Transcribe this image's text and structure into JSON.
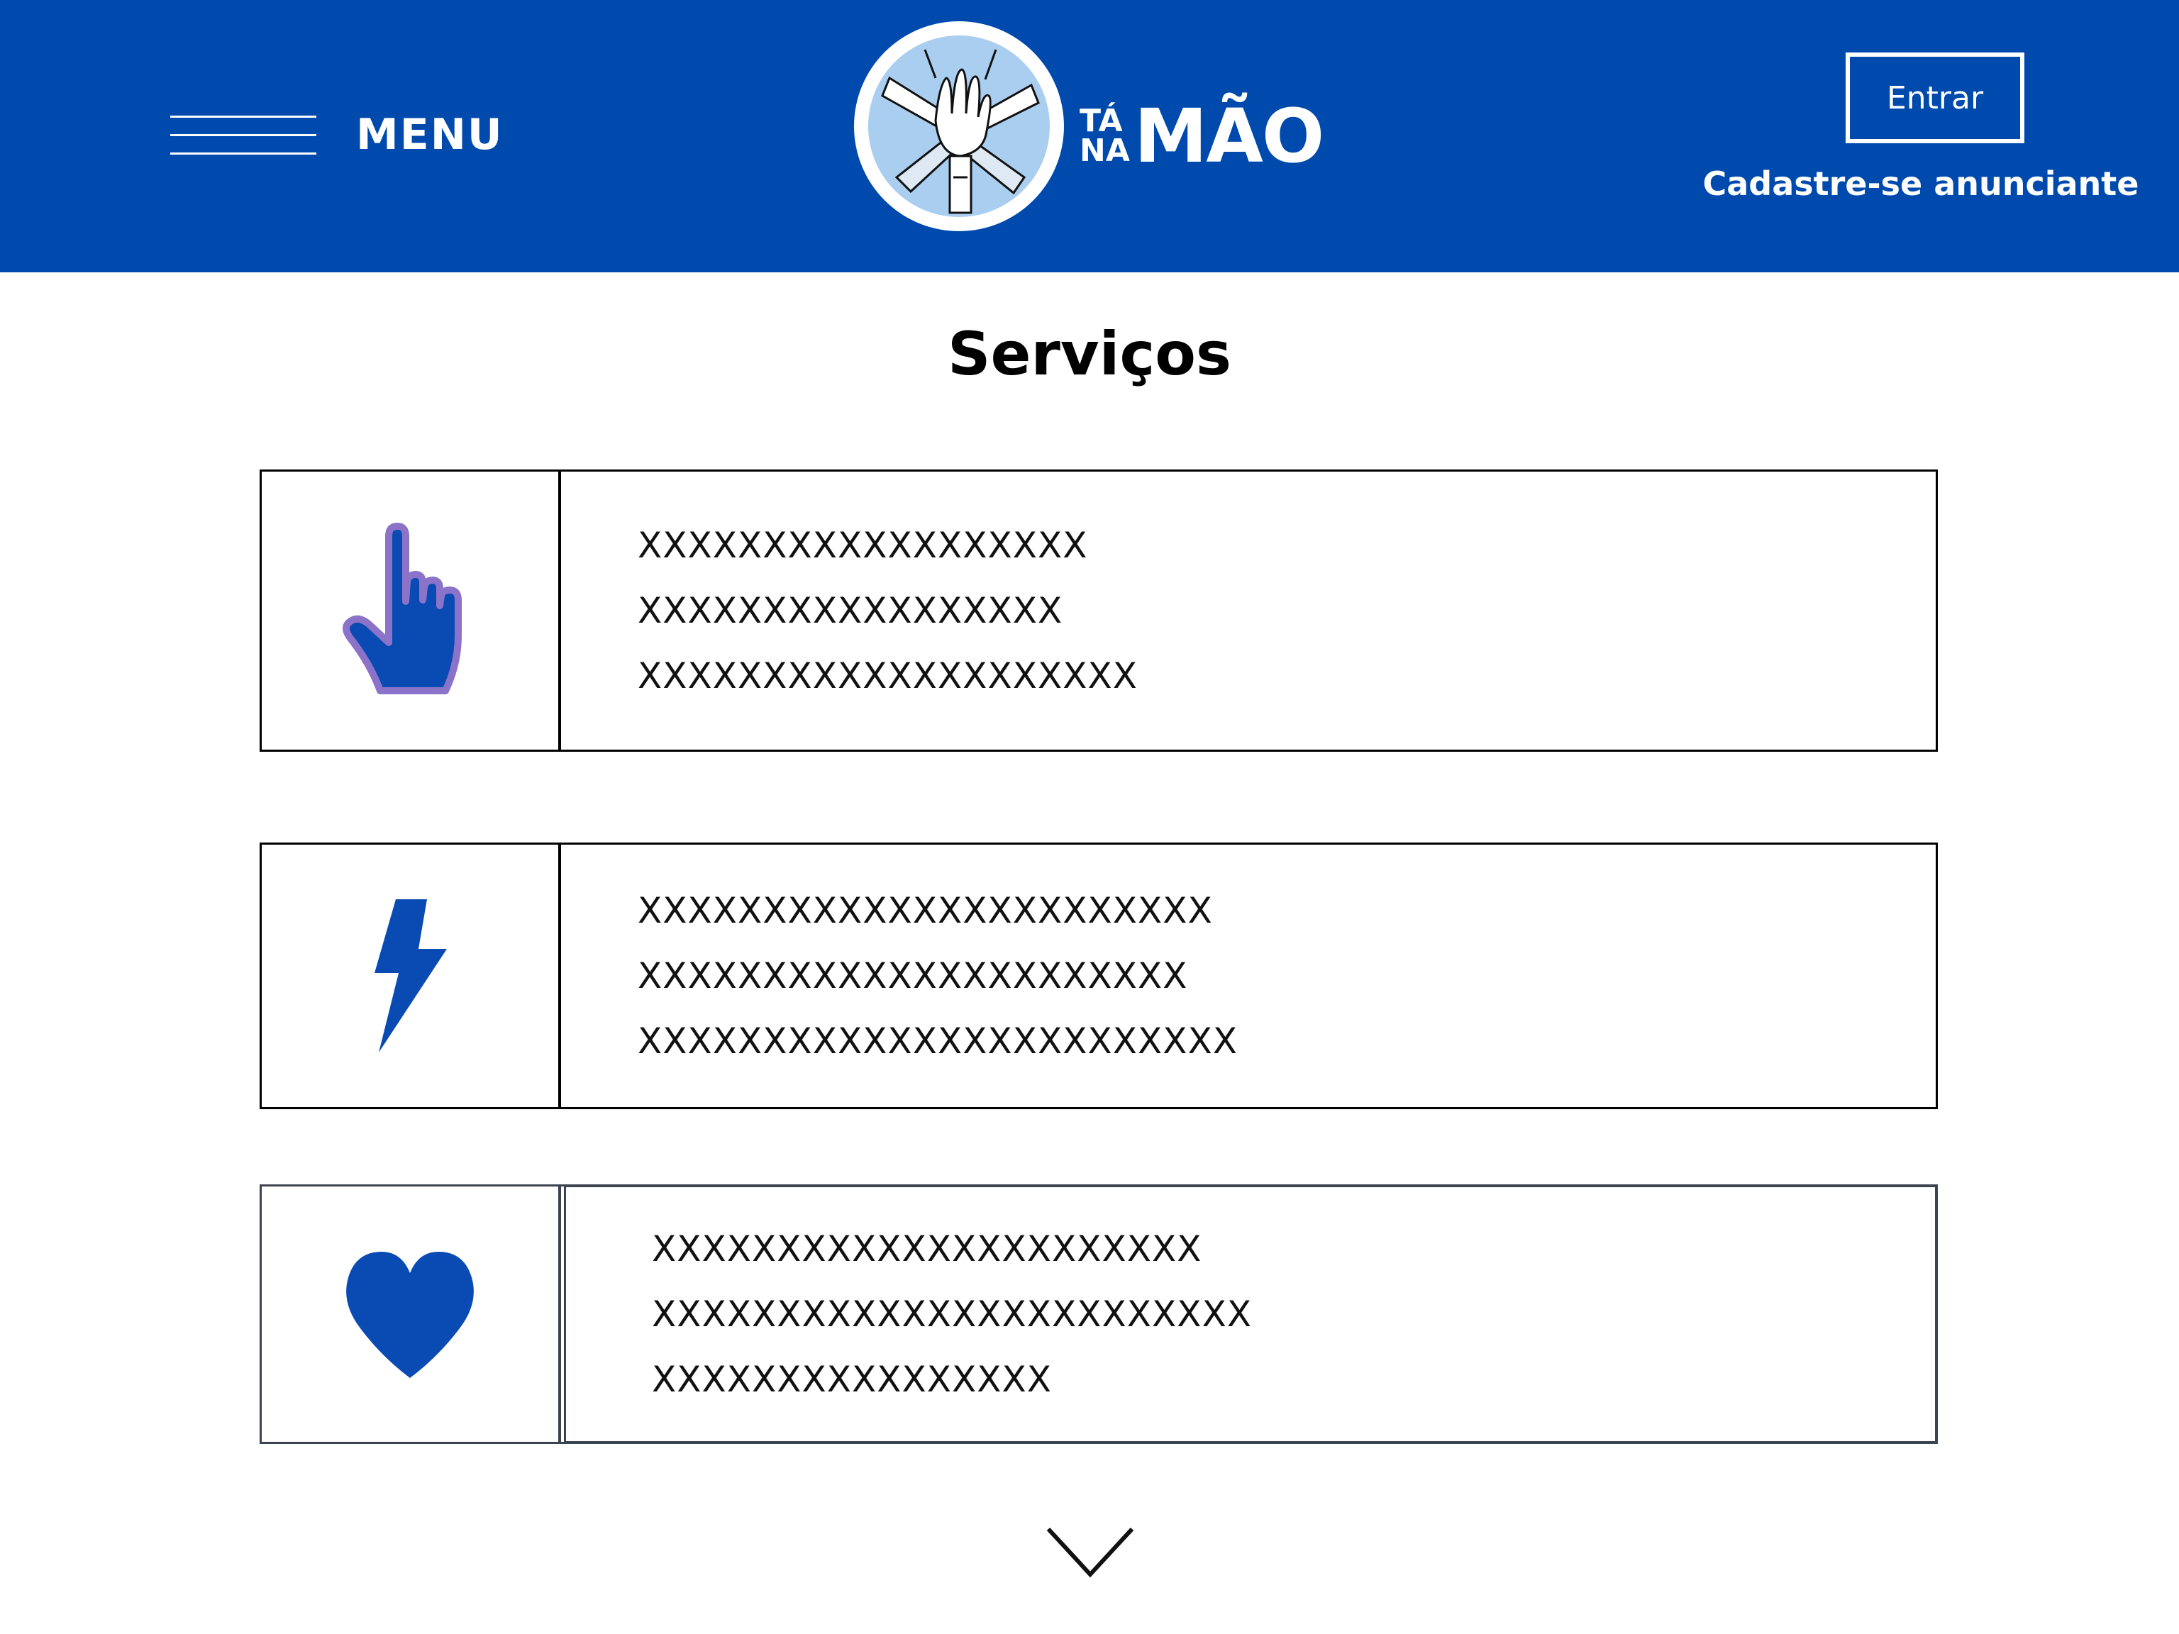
{
  "header": {
    "menu_label": "MENU",
    "logo": {
      "small_top": "TÁ",
      "small_bottom": "NA",
      "big": "MÃO"
    },
    "login_label": "Entrar",
    "register_label": "Cadastre-se anunciante"
  },
  "colors": {
    "brand_blue": "#004aad",
    "icon_blue": "#0a4bb3",
    "hand_outline": "#8b73c9",
    "logo_circle_fill": "#a9cef0"
  },
  "page": {
    "title": "Serviços"
  },
  "services": [
    {
      "icon": "pointing-hand-icon",
      "lines": [
        "XXXXXXXXXXXXXXXXXX",
        "XXXXXXXXXXXXXXXXX",
        "XXXXXXXXXXXXXXXXXXXX"
      ]
    },
    {
      "icon": "lightning-bolt-icon",
      "lines": [
        "XXXXXXXXXXXXXXXXXXXXXXX",
        "XXXXXXXXXXXXXXXXXXXXXX",
        "XXXXXXXXXXXXXXXXXXXXXXXX"
      ]
    },
    {
      "icon": "heart-icon",
      "lines": [
        "XXXXXXXXXXXXXXXXXXXXXX",
        "XXXXXXXXXXXXXXXXXXXXXXXX",
        "XXXXXXXXXXXXXXXX"
      ]
    }
  ],
  "scroll_icon": "chevron-down-icon"
}
